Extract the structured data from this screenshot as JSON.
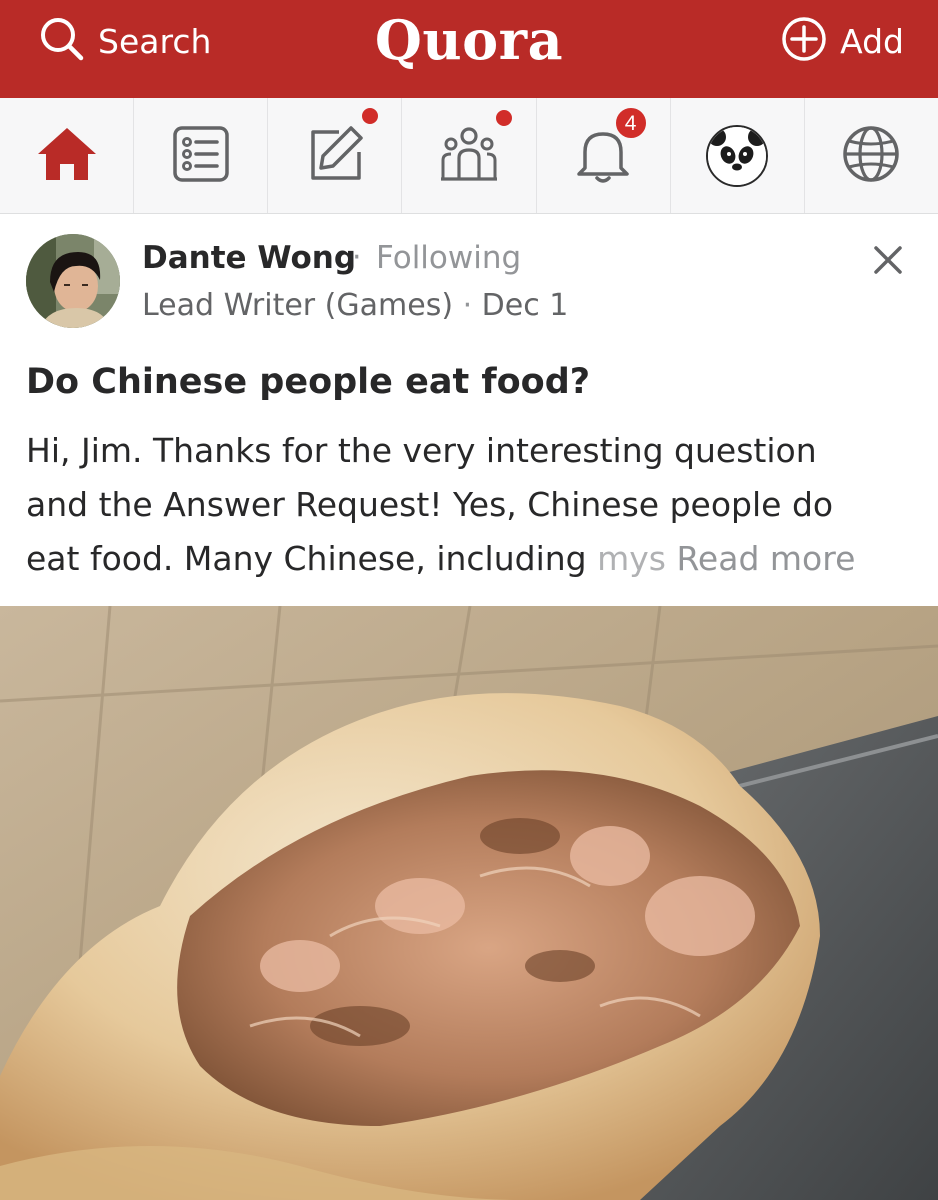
{
  "header": {
    "search_label": "Search",
    "brand": "Quora",
    "add_label": "Add",
    "brand_color": "#b92b27"
  },
  "nav": {
    "items": [
      {
        "icon": "home-icon",
        "active": true
      },
      {
        "icon": "following-feed-icon",
        "unread_dot": true
      },
      {
        "icon": "answer-icon"
      },
      {
        "icon": "spaces-icon",
        "unread_dot": true
      },
      {
        "icon": "notifications-bell-icon",
        "badge": "4"
      },
      {
        "icon": "profile-avatar-panda"
      },
      {
        "icon": "globe-language-icon"
      }
    ]
  },
  "post": {
    "author": "Dante Wong",
    "separator": "·",
    "follow_status": "Following",
    "credential": "Lead Writer (Games)",
    "date": "Dec 1",
    "question": "Do Chinese people eat food?",
    "answer_lines": [
      "Hi, Jim. Thanks for the very interesting question",
      "and the Answer Request! Yes, Chinese people do",
      "eat food. Many Chinese, including "
    ],
    "answer_fade": "mys",
    "read_more": "Read more",
    "image_subject": "rou-jia-mo-sandwich-photo"
  }
}
